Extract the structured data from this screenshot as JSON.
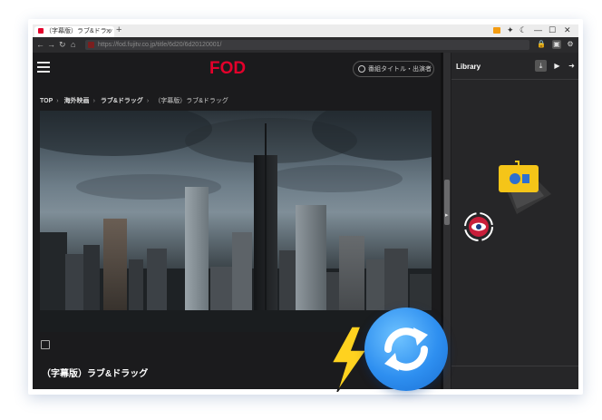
{
  "browser": {
    "tab_title": "（字幕版）ラブ&ドラッグ",
    "tab_close": "✕",
    "new_tab": "+",
    "url": "https://fod.fujitv.co.jp/title/6d20/6d20120001/",
    "window_controls": [
      "—",
      "☐",
      "✕"
    ]
  },
  "site": {
    "logo": "FOD",
    "search_placeholder": "番組タイトル・出演者",
    "breadcrumb": [
      "TOP",
      "海外映画",
      "ラブ&ドラッグ",
      "（字幕版）ラブ&ドラッグ"
    ],
    "breadcrumb_sep": "›",
    "title": "（字幕版）ラブ&ドラッグ"
  },
  "library": {
    "title": "Library"
  },
  "colors": {
    "fod_red": "#e4002b",
    "badge_blue": "#2e8ff0",
    "bolt_yellow": "#ffd21f",
    "camera_yellow": "#f5c518"
  },
  "icons": [
    "menu-icon",
    "search-icon",
    "download-icon",
    "video-icon",
    "export-icon",
    "sync-icon",
    "lightning-icon",
    "camera-icon",
    "eye-icon"
  ]
}
